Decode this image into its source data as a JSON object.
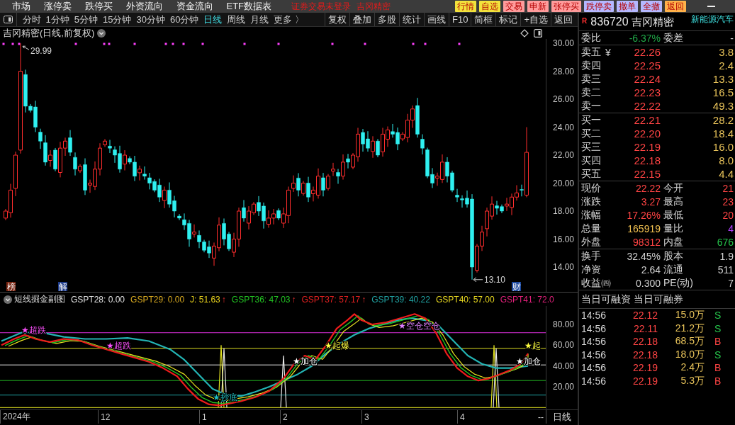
{
  "menu_bar": {
    "items": [
      "市场",
      "涨停卖",
      "跌停买",
      "外资流向",
      "资金流向",
      "ETF数据表"
    ],
    "notice": "证券交易未登录",
    "stock": "吉冈精密",
    "buttons": [
      {
        "label": "行情",
        "color": "#f2e33c"
      },
      {
        "label": "自选",
        "color": "#f2e33c"
      },
      {
        "label": "交易",
        "color": "#ff9c9c"
      },
      {
        "label": "申新",
        "color": "#ff9c9c"
      },
      {
        "label": "张停买",
        "color": "#ff9c9c"
      },
      {
        "label": "跌停卖",
        "color": "#b4b8ff"
      },
      {
        "label": "撤单",
        "color": "#b4b8ff"
      },
      {
        "label": "全撤",
        "color": "#b4b8ff"
      },
      {
        "label": "返回",
        "color": "#ffb24a"
      }
    ]
  },
  "toolbar": {
    "periods": [
      {
        "label": "分时",
        "selected": false
      },
      {
        "label": "1分钟",
        "selected": false
      },
      {
        "label": "5分钟",
        "selected": false
      },
      {
        "label": "15分钟",
        "selected": false
      },
      {
        "label": "30分钟",
        "selected": false
      },
      {
        "label": "60分钟",
        "selected": false
      },
      {
        "label": "日线",
        "selected": true
      },
      {
        "label": "周线",
        "selected": false
      },
      {
        "label": "月线",
        "selected": false
      },
      {
        "label": "更多 〉",
        "selected": false
      }
    ],
    "tools": [
      "复权",
      "叠加",
      "多股",
      "统计",
      "画线",
      "F10",
      "简框",
      "标记",
      "+自选",
      "返回"
    ]
  },
  "price_chart": {
    "title": "吉冈精密(日线,前复权)",
    "axis_labels": [
      "30.00",
      "28.00",
      "26.00",
      "24.00",
      "22.00",
      "20.00",
      "18.00",
      "16.00",
      "14.00"
    ],
    "high_label": "29.99",
    "low_label": "13.10",
    "markers": [
      {
        "text": "榜",
        "color": "#7a2410"
      },
      {
        "text": "解",
        "color": "#1d3b8a"
      },
      {
        "text": "财",
        "color": "#1d4aa0"
      }
    ]
  },
  "indicator": {
    "title": "短线掘金副图",
    "values": [
      {
        "label": "GSPT28: 0.00",
        "color": "#e0e0e0"
      },
      {
        "label": "GSPT29: 0.00",
        "color": "#d6a820"
      },
      {
        "label": "J: 51.63",
        "color": "#e8d21c",
        "arrow": "↑"
      },
      {
        "label": "GSPT36: 47.03",
        "color": "#22c322",
        "arrow": "↑"
      },
      {
        "label": "GSPT37: 57.17",
        "color": "#e02020",
        "arrow": "↑"
      },
      {
        "label": "GSPT39: 40.22",
        "color": "#20a0a0"
      },
      {
        "label": "GSPT40: 57.00",
        "color": "#e8d820"
      },
      {
        "label": "GSPT41: 72.0",
        "color": "#e0207a"
      }
    ],
    "axis_labels": [
      "80.00",
      "60.00",
      "40.00",
      "20.00"
    ],
    "signals": [
      {
        "text": "★超跌",
        "color": "#ff50ff"
      },
      {
        "text": "★超跌",
        "color": "#ff50ff"
      },
      {
        "text": "★抄底",
        "color": "#20c0c0"
      },
      {
        "text": "★加仓",
        "color": "#ffffff"
      },
      {
        "text": "★起爆",
        "color": "#ffff40"
      },
      {
        "text": "★空仓空仓",
        "color": "#e080ff"
      },
      {
        "text": "★加仓",
        "color": "#ffffff"
      },
      {
        "text": "★起",
        "color": "#ffff40"
      }
    ]
  },
  "date_axis": {
    "labels": [
      "2024年",
      "12",
      "1",
      "2",
      "3",
      "4"
    ],
    "end_mark": "--",
    "period_button": "日线"
  },
  "quote_panel": {
    "flag": "R",
    "code": "836720",
    "name": "吉冈精密",
    "sector": "新能源汽车",
    "ratio": {
      "left": {
        "label": "委比",
        "value": "-6.37%"
      },
      "right": {
        "label": "委差",
        "value": "-"
      }
    },
    "asks": [
      {
        "label": "卖五",
        "mark": "¥",
        "price": "22.26",
        "volume": "3.8"
      },
      {
        "label": "卖四",
        "price": "22.25",
        "volume": "2.4"
      },
      {
        "label": "卖三",
        "price": "22.24",
        "volume": "13.3"
      },
      {
        "label": "卖二",
        "price": "22.23",
        "volume": "16.5"
      },
      {
        "label": "卖一",
        "price": "22.22",
        "volume": "49.3"
      }
    ],
    "bids": [
      {
        "label": "买一",
        "price": "22.21",
        "volume": "28.2"
      },
      {
        "label": "买二",
        "price": "22.20",
        "volume": "18.4"
      },
      {
        "label": "买三",
        "price": "22.19",
        "volume": "16.0"
      },
      {
        "label": "买四",
        "price": "22.18",
        "volume": "8.0"
      },
      {
        "label": "买五",
        "price": "22.15",
        "volume": "4.4"
      }
    ],
    "stats": [
      {
        "left": {
          "label": "现价",
          "value": "22.22",
          "color": "#ff4444"
        },
        "right": {
          "label": "今开",
          "value": "21",
          "color": "#ff4444"
        }
      },
      {
        "left": {
          "label": "涨跌",
          "value": "3.27",
          "color": "#ff4444"
        },
        "right": {
          "label": "最高",
          "value": "23",
          "color": "#ff4444"
        }
      },
      {
        "left": {
          "label": "涨幅",
          "value": "17.26%",
          "color": "#ff4444"
        },
        "right": {
          "label": "最低",
          "value": "20",
          "color": "#ff4444"
        }
      },
      {
        "left": {
          "label": "总量",
          "value": "165919",
          "color": "#f0c050"
        },
        "right": {
          "label": "量比",
          "value": "4",
          "color": "#b040ff"
        }
      },
      {
        "left": {
          "label": "外盘",
          "value": "98312",
          "color": "#ff4444"
        },
        "right": {
          "label": "内盘",
          "value": "676",
          "color": "#25c24a"
        }
      }
    ],
    "fundamentals": [
      {
        "left": {
          "label": "换手",
          "value": "32.45%"
        },
        "right": {
          "label": "股本",
          "value": "1.9"
        }
      },
      {
        "left": {
          "label": "净资",
          "value": "2.64"
        },
        "right": {
          "label": "流通",
          "value": "511"
        }
      },
      {
        "left": {
          "label": "收益㈣",
          "value": "0.300"
        },
        "right": {
          "label": "PE(动)",
          "value": "7"
        }
      }
    ],
    "margin": [
      "当日可融资",
      "当日可融券"
    ],
    "ticks": [
      {
        "time": "14:56",
        "price": "22.12",
        "volume": "15.0万",
        "side": "S",
        "color": "#25c24a"
      },
      {
        "time": "14:56",
        "price": "22.11",
        "volume": "21.2万",
        "side": "S",
        "color": "#25c24a"
      },
      {
        "time": "14:56",
        "price": "22.18",
        "volume": "68.5万",
        "side": "B",
        "color": "#ff4444"
      },
      {
        "time": "14:56",
        "price": "22.18",
        "volume": "18.0万",
        "side": "S",
        "color": "#25c24a"
      },
      {
        "time": "14:56",
        "price": "22.19",
        "volume": "2.4万",
        "side": "B",
        "color": "#ff4444"
      },
      {
        "time": "14:56",
        "price": "22.19",
        "volume": "5.3万",
        "side": "B",
        "color": "#ff4444"
      }
    ]
  }
}
